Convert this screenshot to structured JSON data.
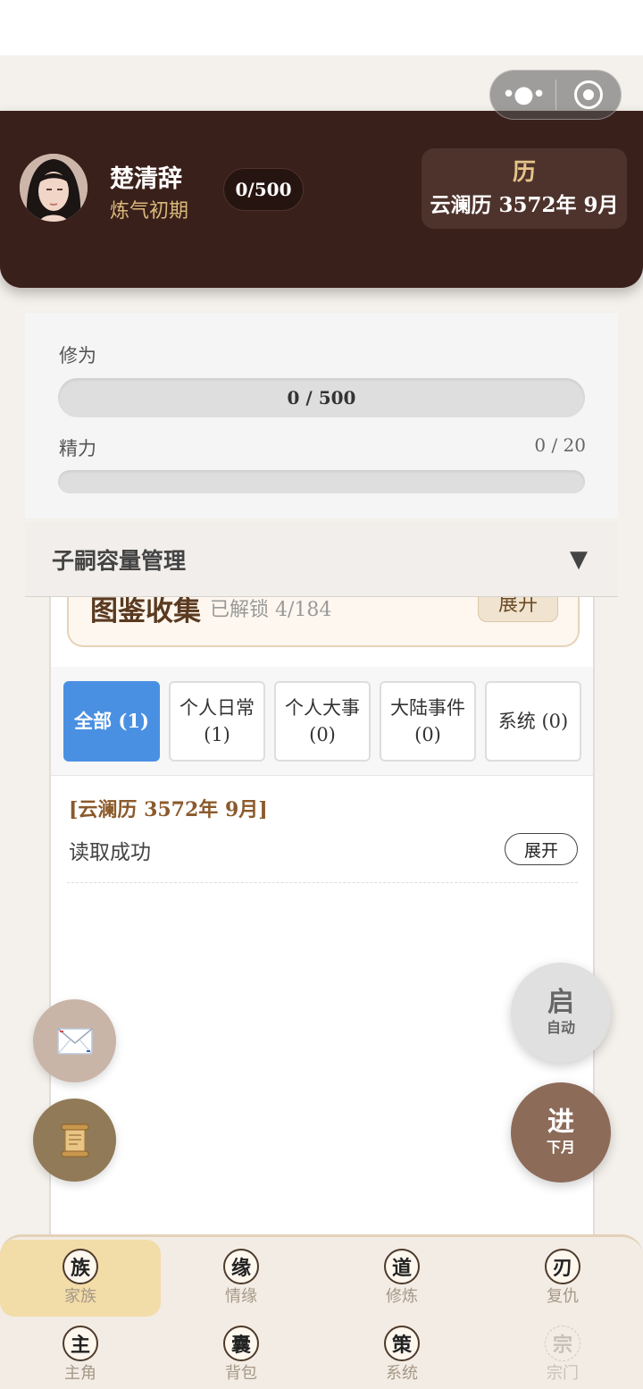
{
  "header": {
    "name": "楚清辞",
    "realm": "炼气初期",
    "xp_pill": "0/500",
    "calendar_icon": "历",
    "calendar_date": "云澜历 3572年 9月"
  },
  "capsule": {
    "more_icon": "more-dots-icon",
    "close_icon": "target-circle-icon"
  },
  "stats": {
    "cultivation_label": "修为",
    "cultivation_value": "0 / 500",
    "cultivation_progress": 0,
    "energy_label": "精力",
    "energy_value": "0 / 20",
    "energy_progress": 0
  },
  "offspring_panel": {
    "title": "子嗣容量管理",
    "toggle": "▼"
  },
  "codex": {
    "title": "图鉴收集",
    "subtitle": "已解锁 4/184",
    "button": "展开"
  },
  "filters": [
    {
      "label": "全部 (1)",
      "active": true
    },
    {
      "label": "个人日常 (1)",
      "active": false
    },
    {
      "label": "个人大事 (0)",
      "active": false
    },
    {
      "label": "大陆事件 (0)",
      "active": false
    },
    {
      "label": "系统 (0)",
      "active": false
    }
  ],
  "log": {
    "date": "[云澜历 3572年 9月]",
    "text": "读取成功",
    "expand": "展开"
  },
  "fabs": {
    "mail_icon": "envelope-icon",
    "scroll_icon": "scroll-icon",
    "auto_big": "启",
    "auto_small": "自动",
    "next_big": "进",
    "next_small": "下月"
  },
  "nav": [
    {
      "icon": "族",
      "label": "家族",
      "active": true
    },
    {
      "icon": "缘",
      "label": "情缘",
      "active": false
    },
    {
      "icon": "道",
      "label": "修炼",
      "active": false
    },
    {
      "icon": "刃",
      "label": "复仇",
      "active": false
    },
    {
      "icon": "主",
      "label": "主角",
      "active": false
    },
    {
      "icon": "囊",
      "label": "背包",
      "active": false
    },
    {
      "icon": "策",
      "label": "系统",
      "active": false
    },
    {
      "icon": "宗",
      "label": "宗门",
      "active": false,
      "disabled": true
    }
  ],
  "colors": {
    "header_bg": "#3a201b",
    "accent_gold": "#d9b97a",
    "active_filter": "#4a90e2",
    "log_date": "#8b5a2b",
    "next_fab": "#8d6b59",
    "auto_fab": "#e0e0e0",
    "active_nav": "#f2dca8"
  }
}
